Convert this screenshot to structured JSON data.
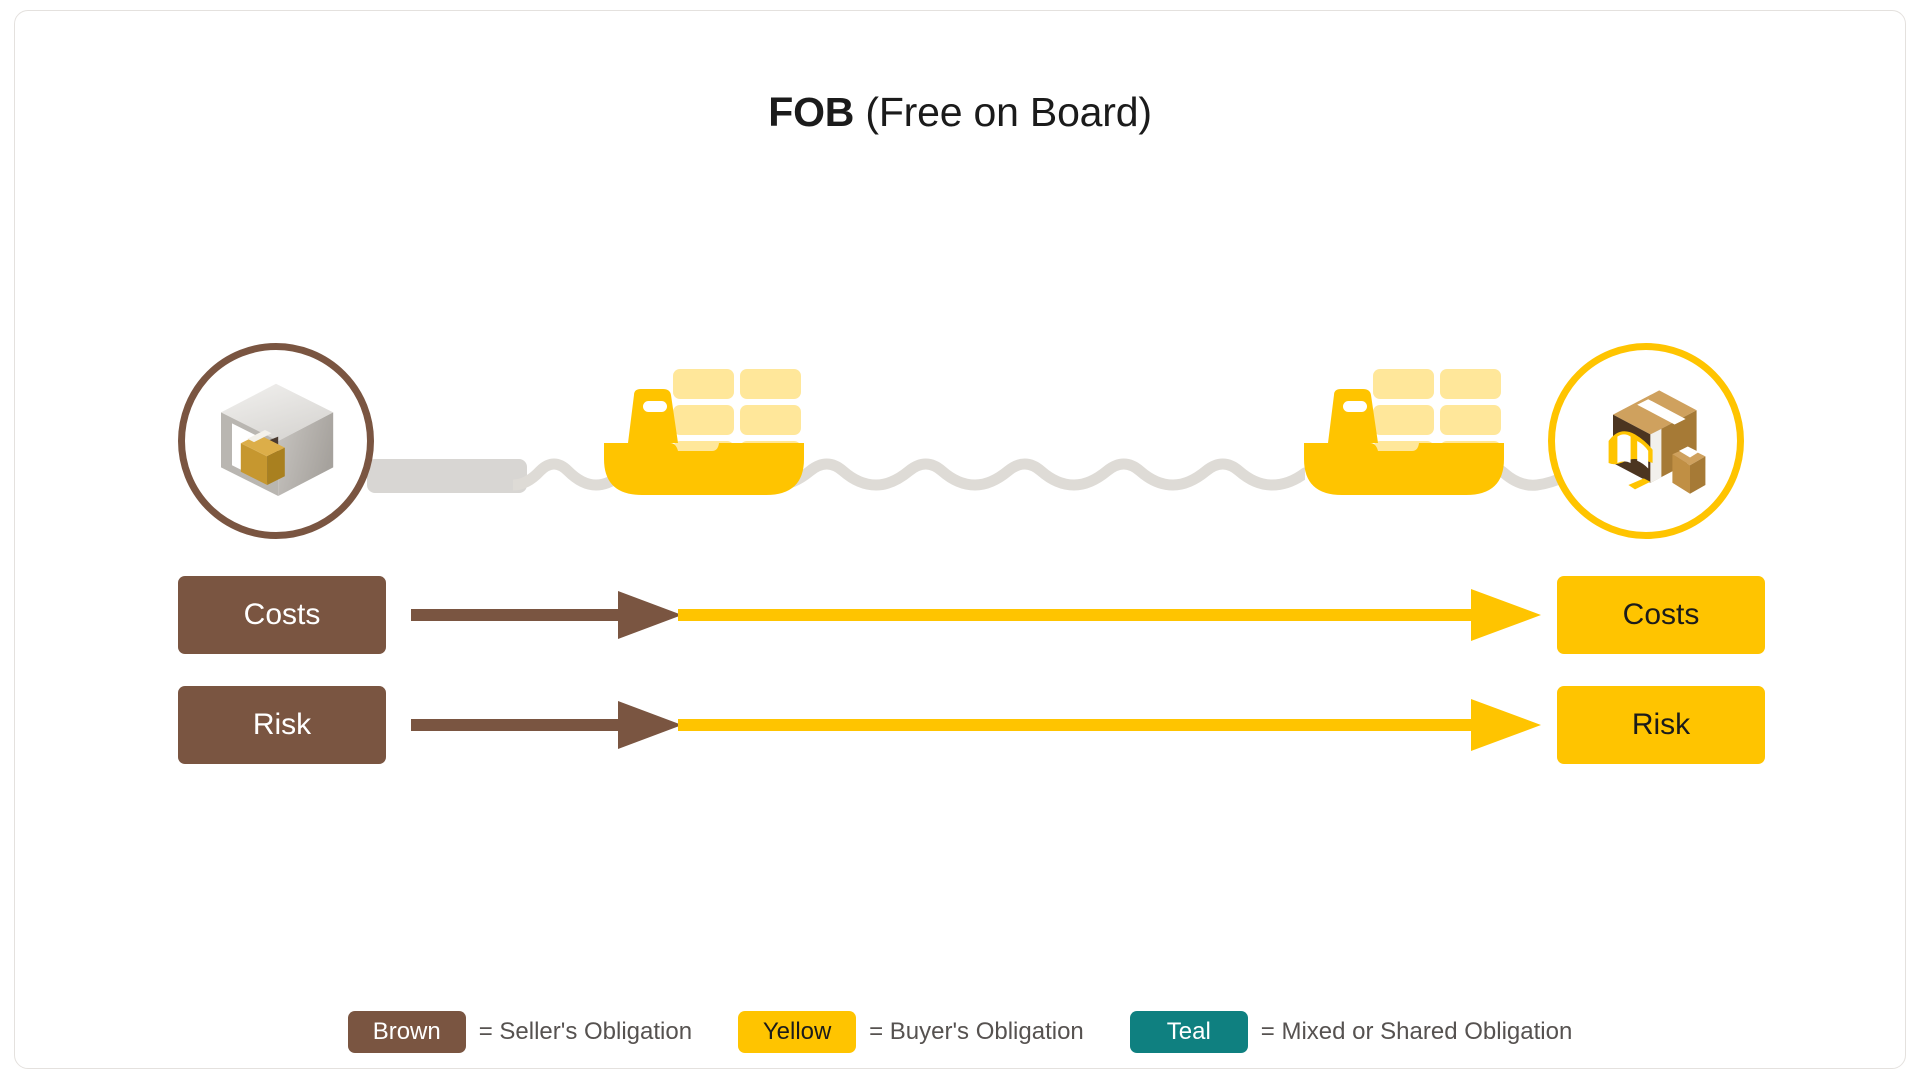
{
  "title": {
    "code": "FOB",
    "description": "(Free on Board)"
  },
  "journey": {
    "origin": {
      "icon": "warehouse-icon",
      "ring_color": "#7a5541"
    },
    "destination": {
      "icon": "shop-icon",
      "ring_color": "#ffc400"
    },
    "transport": [
      {
        "icon": "road-segment",
        "color": "#d8d6d3"
      },
      {
        "icon": "wave-line",
        "color": "#dedbd6"
      },
      {
        "icon": "cargo-ship-icon",
        "color": "#ffc400"
      },
      {
        "icon": "wave-line",
        "color": "#dedbd6"
      },
      {
        "icon": "cargo-ship-icon",
        "color": "#ffc400"
      },
      {
        "icon": "wave-line",
        "color": "#dedbd6"
      }
    ]
  },
  "rows": [
    {
      "key": "costs",
      "left_label": "Costs",
      "right_label": "Costs",
      "seller_color": "#7a5541",
      "buyer_color": "#ffc400",
      "seller_fraction": 0.21
    },
    {
      "key": "risk",
      "left_label": "Risk",
      "right_label": "Risk",
      "seller_color": "#7a5541",
      "buyer_color": "#ffc400",
      "seller_fraction": 0.21
    }
  ],
  "legend": [
    {
      "chip": "Brown",
      "chip_color": "#7a5541",
      "chip_text_color": "#ffffff",
      "text": "= Seller's Obligation"
    },
    {
      "chip": "Yellow",
      "chip_color": "#ffc400",
      "chip_text_color": "#1b1b1b",
      "text": "= Buyer's Obligation"
    },
    {
      "chip": "Teal",
      "chip_color": "#0f8080",
      "chip_text_color": "#ffffff",
      "text": "= Mixed or Shared Obligation"
    }
  ]
}
